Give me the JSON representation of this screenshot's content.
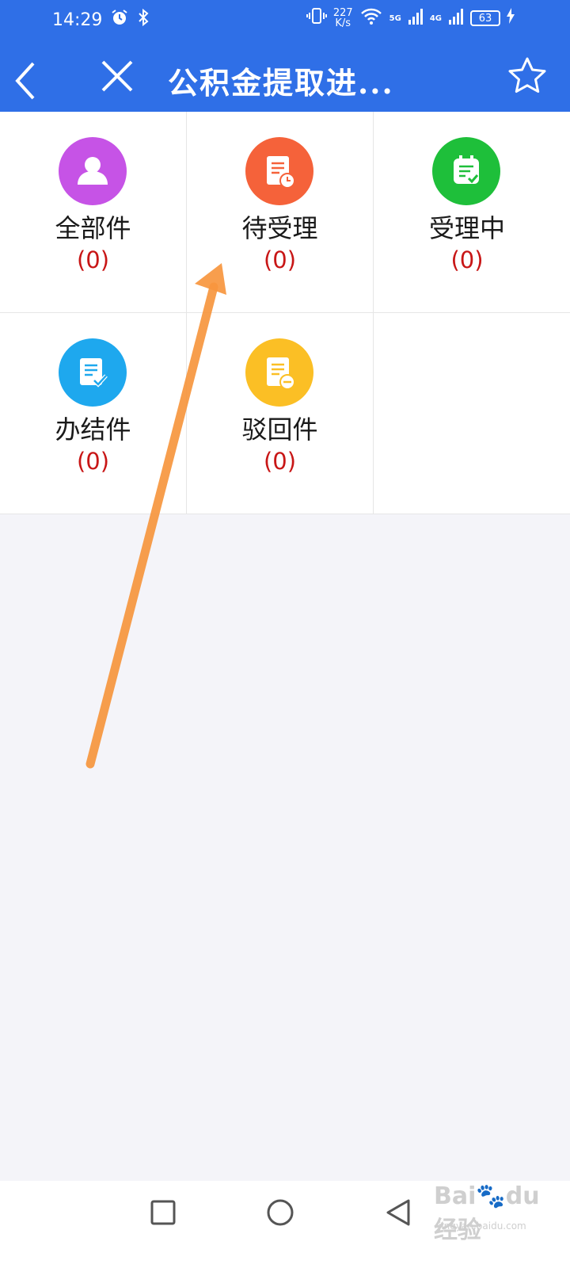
{
  "status_bar": {
    "time": "14:29",
    "speed_value": "227",
    "speed_unit": "K/s",
    "net1": "5G",
    "net2": "4G",
    "battery": "63"
  },
  "nav": {
    "title": "公积金提取进..."
  },
  "grid": {
    "items": [
      {
        "label": "全部件",
        "count": "(0)",
        "color": "#c653e6",
        "icon": "person-icon"
      },
      {
        "label": "待受理",
        "count": "(0)",
        "color": "#f5623a",
        "icon": "document-clock-icon"
      },
      {
        "label": "受理中",
        "count": "(0)",
        "color": "#1ebf3a",
        "icon": "clipboard-check-icon"
      },
      {
        "label": "办结件",
        "count": "(0)",
        "color": "#1ea8ee",
        "icon": "document-check-icon"
      },
      {
        "label": "驳回件",
        "count": "(0)",
        "color": "#fbbf25",
        "icon": "document-minus-icon"
      }
    ]
  },
  "watermark": {
    "brand": "Bai",
    "brand_suffix": "du",
    "product": "经验",
    "url": "jingyan.baidu.com"
  },
  "colors": {
    "header": "#2f6fe7",
    "count_red": "#c81616",
    "arrow": "#f7963e"
  }
}
